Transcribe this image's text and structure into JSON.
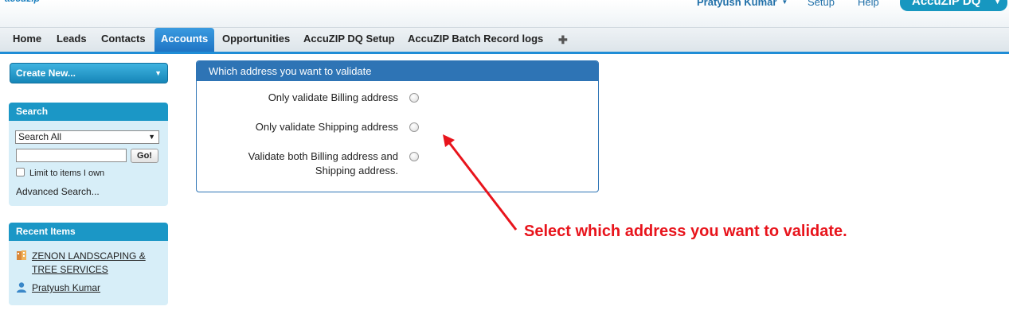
{
  "header": {
    "logo": "accuzip",
    "user_name": "Pratyush Kumar",
    "setup": "Setup",
    "help": "Help",
    "app_name": "AccuZIP DQ"
  },
  "tabs": [
    {
      "label": "Home",
      "active": false
    },
    {
      "label": "Leads",
      "active": false
    },
    {
      "label": "Contacts",
      "active": false
    },
    {
      "label": "Accounts",
      "active": true
    },
    {
      "label": "Opportunities",
      "active": false
    },
    {
      "label": "AccuZIP DQ Setup",
      "active": false
    },
    {
      "label": "AccuZIP Batch Record logs",
      "active": false
    }
  ],
  "sidebar": {
    "create_new": "Create New...",
    "search": {
      "title": "Search",
      "scope": "Search All",
      "input_value": "",
      "go_label": "Go!",
      "limit_label": "Limit to items I own",
      "limit_checked": false,
      "advanced_link": "Advanced Search..."
    },
    "recent": {
      "title": "Recent Items",
      "items": [
        {
          "label": "ZENON LANDSCAPING & TREE SERVICES",
          "icon": "account-icon"
        },
        {
          "label": "Pratyush Kumar",
          "icon": "user-icon"
        }
      ]
    }
  },
  "main": {
    "title": "Which address you want to validate",
    "options": [
      {
        "label": "Only validate Billing address",
        "checked": false
      },
      {
        "label": "Only validate Shipping address",
        "checked": false
      },
      {
        "label": "Validate both Billing address and Shipping address.",
        "checked": false
      }
    ]
  },
  "annotation": {
    "text": "Select which address you want to validate.",
    "color": "#e8141c"
  },
  "colors": {
    "accent": "#1f8dd6",
    "panel_header": "#2e74b5",
    "sidebar_bg": "#d7eef8"
  }
}
